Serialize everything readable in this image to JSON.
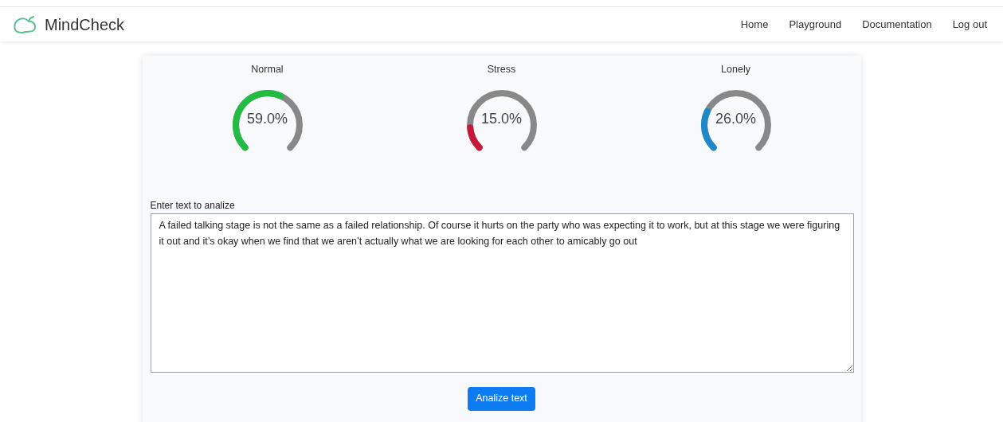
{
  "navbar": {
    "brand": "MindCheck",
    "links": [
      {
        "label": "Home"
      },
      {
        "label": "Playground"
      },
      {
        "label": "Documentation"
      },
      {
        "label": "Log out"
      }
    ]
  },
  "gauges": [
    {
      "label": "Normal",
      "reading": "59.0%",
      "color": "#22bb44"
    },
    {
      "label": "Stress",
      "reading": "15.0%",
      "color": "#c8183a"
    },
    {
      "label": "Lonely",
      "reading": "26.0%",
      "color": "#1e88c8"
    }
  ],
  "input": {
    "label": "Enter text to analize",
    "value": "A failed talking stage is not the same as a failed relationship. Of course it hurts on the party who was expecting it to work, but at this stage we were figuring it out and it’s okay when we find that we aren’t actually what we are looking for each other to amicably go out"
  },
  "button": {
    "label": "Analize text"
  }
}
